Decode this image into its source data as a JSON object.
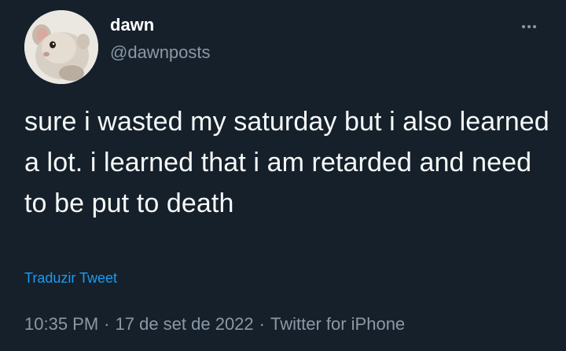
{
  "author": {
    "display_name": "dawn",
    "handle": "@dawnposts",
    "avatar_icon": "hamster-avatar"
  },
  "more_icon": "more-horizontal-icon",
  "tweet": {
    "text": "sure i wasted my saturday but i also learned a lot. i learned that i am retarded and need to be put to death",
    "translate_label": "Traduzir Tweet"
  },
  "meta": {
    "time": "10:35 PM",
    "separator": "·",
    "date": "17 de set de 2022",
    "source": "Twitter for iPhone"
  },
  "colors": {
    "background": "#15202b",
    "text": "#f7f9f9",
    "secondary": "#8b98a5",
    "link": "#1d9bf0"
  }
}
